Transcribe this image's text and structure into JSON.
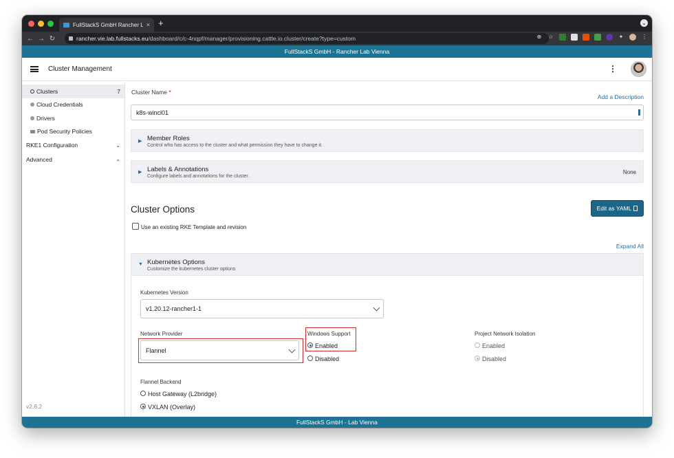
{
  "browser": {
    "tab_title": "FullStackS GmbH Rancher Lab",
    "tab_close": "×",
    "new_tab": "+",
    "url_host": "rancher.vie.lab.fullstacks.eu",
    "url_path": "/dashboard/c/c-4nqpf/manager/provisioning.cattle.io.cluster/create?type=custom"
  },
  "top_banner": "FullStackS GmbH - Rancher Lab Vienna",
  "header": {
    "title": "Cluster Management"
  },
  "sidebar": {
    "items": [
      {
        "label": "Clusters",
        "count": "7"
      },
      {
        "label": "Cloud Credentials"
      },
      {
        "label": "Drivers"
      },
      {
        "label": "Pod Security Policies"
      }
    ],
    "groups": [
      {
        "label": "RKE1 Configuration"
      },
      {
        "label": "Advanced"
      }
    ],
    "version": "v2.6.2"
  },
  "form": {
    "cluster_name_label": "Cluster Name",
    "required_mark": "*",
    "add_description": "Add a Description",
    "cluster_name_value": "k8s-wincl01",
    "member_roles": {
      "title": "Member Roles",
      "subtitle": "Control who has access to the cluster and what permission they have to change it."
    },
    "labels": {
      "title": "Labels & Annotations",
      "subtitle": "Configure labels and annotations for the cluster.",
      "status": "None"
    },
    "cluster_options_title": "Cluster Options",
    "edit_yaml": "Edit as YAML",
    "rke_template_label": "Use an existing RKE Template and revision",
    "expand_all": "Expand All",
    "k8s_options": {
      "title": "Kubernetes Options",
      "subtitle": "Customize the kubernetes cluster options"
    },
    "k8s_version_label": "Kubernetes Version",
    "k8s_version_value": "v1.20.12-rancher1-1",
    "network_provider_label": "Network Provider",
    "network_provider_value": "Flannel",
    "windows_support_label": "Windows Support",
    "windows_enabled": "Enabled",
    "windows_disabled": "Disabled",
    "project_isolation_label": "Project Network Isolation",
    "isolation_enabled": "Enabled",
    "isolation_disabled": "Disabled",
    "flannel_backend_label": "Flannel Backend",
    "backend_host_gw": "Host Gateway (L2bridge)",
    "backend_vxlan": "VXLAN (Overlay)"
  },
  "bottom_banner": "FullStackS GmbH - Lab Vienna",
  "colors": {
    "banner": "#1d7394",
    "accent": "#1d6fa5",
    "highlight_box": "#d32f2f"
  }
}
